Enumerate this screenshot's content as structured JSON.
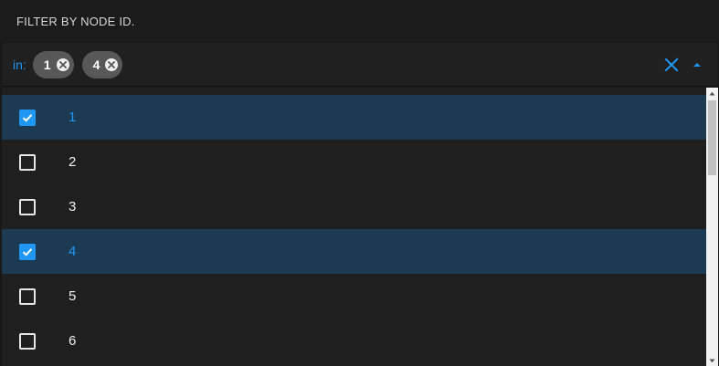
{
  "header": {
    "title": "FILTER BY NODE ID."
  },
  "filter": {
    "operator_label": "in:",
    "chips": [
      {
        "label": "1"
      },
      {
        "label": "4"
      }
    ],
    "clear_icon": "close-icon",
    "collapse_icon": "caret-up-icon"
  },
  "list": {
    "items": [
      {
        "label": "1",
        "checked": true
      },
      {
        "label": "2",
        "checked": false
      },
      {
        "label": "3",
        "checked": false
      },
      {
        "label": "4",
        "checked": true
      },
      {
        "label": "5",
        "checked": false
      },
      {
        "label": "6",
        "checked": false
      }
    ]
  },
  "colors": {
    "accent": "#2196f3",
    "selected_row": "#1d3a53",
    "background": "#1f1f1f",
    "chip": "#585858"
  }
}
